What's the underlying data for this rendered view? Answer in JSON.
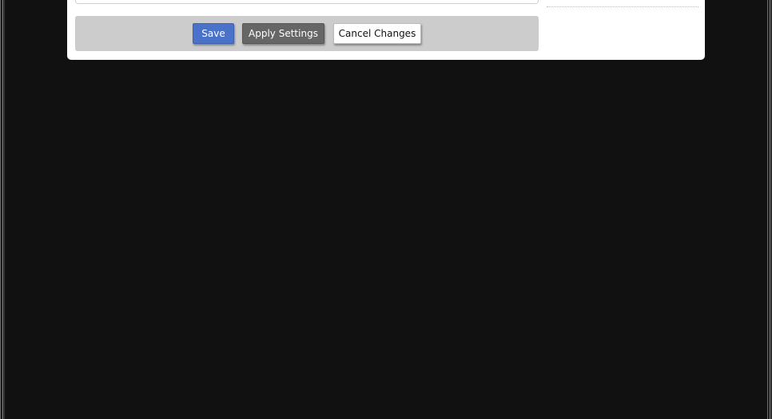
{
  "actions": {
    "save_label": "Save",
    "apply_label": "Apply Settings",
    "cancel_label": "Cancel Changes"
  },
  "colors": {
    "background": "#111111",
    "panel": "#ffffff",
    "action_bar": "#cccccc",
    "save_button": "#4a72c8",
    "apply_button": "#666666",
    "cancel_button": "#ffffff"
  }
}
